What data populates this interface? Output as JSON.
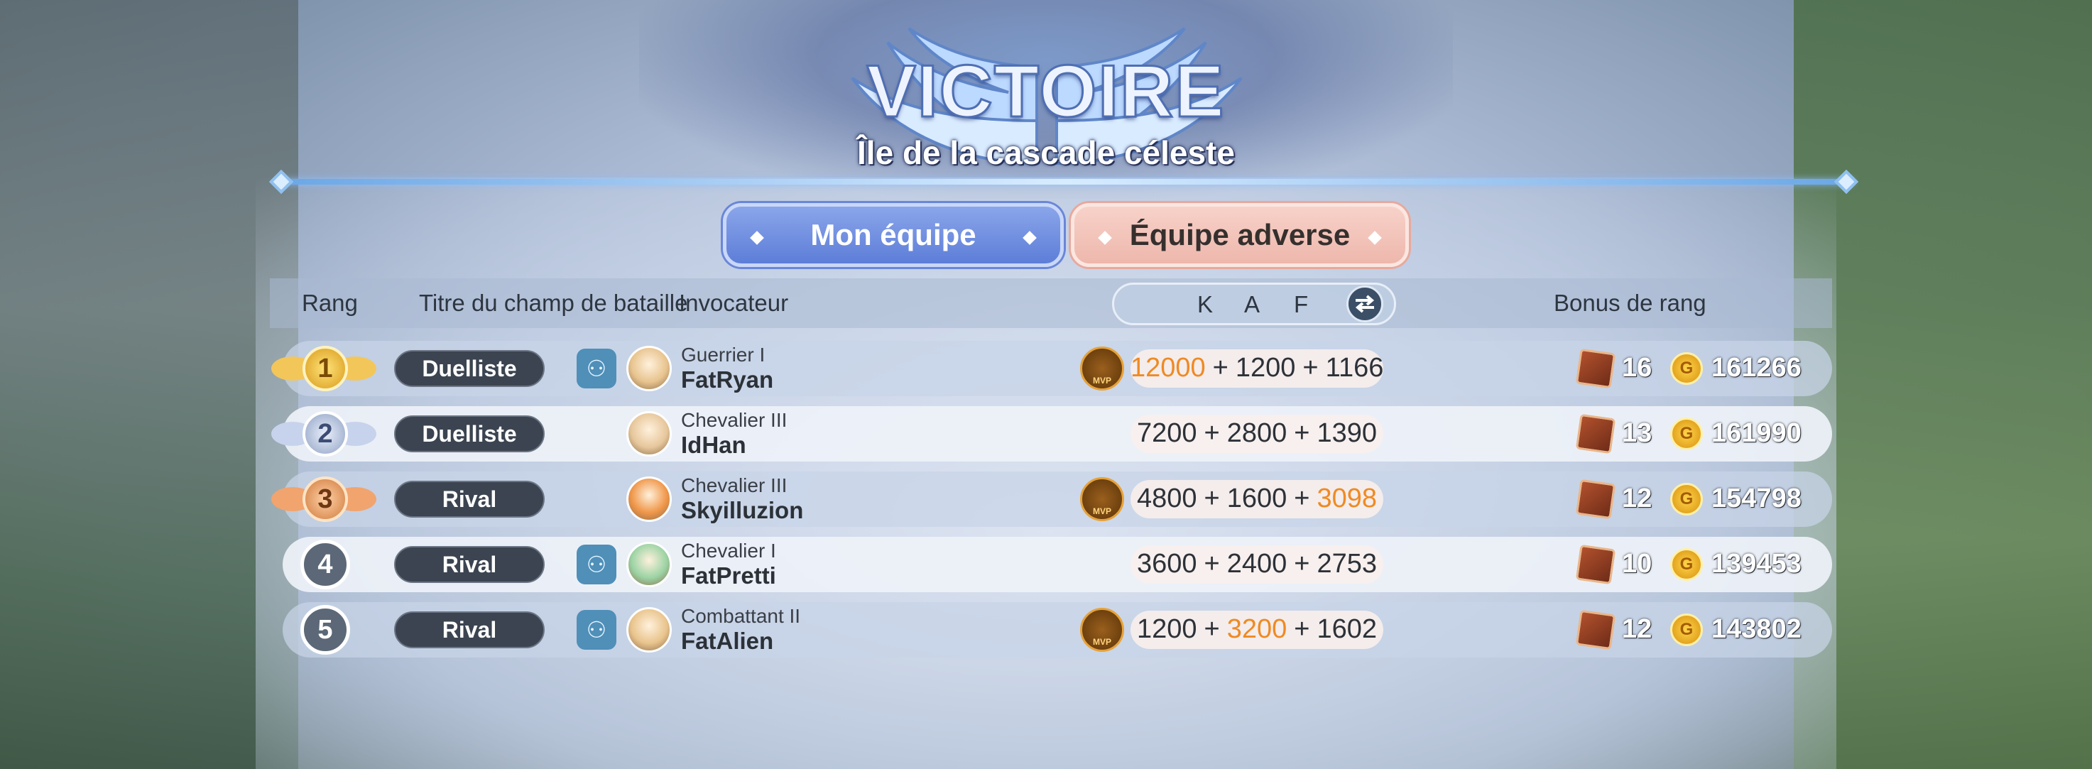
{
  "header": {
    "title": "VICTOIRE",
    "subtitle": "Île de la cascade céleste"
  },
  "tabs": {
    "mine": "Mon équipe",
    "enemy": "Équipe adverse"
  },
  "columns": {
    "rank": "Rang",
    "title": "Titre du champ de bataille",
    "summoner": "Invocateur",
    "k": "K",
    "a": "A",
    "f": "F",
    "bonus": "Bonus de rang"
  },
  "rows": [
    {
      "rank": "1",
      "title": "Duelliste",
      "party": true,
      "summoner_rank": "Guerrier I",
      "name": "FatRyan",
      "mvp": true,
      "mvp_label": "MVP",
      "k": "12000",
      "a": "1200",
      "f": "1166",
      "highlight": "k",
      "boxes": "16",
      "gold": "161266"
    },
    {
      "rank": "2",
      "title": "Duelliste",
      "party": false,
      "summoner_rank": "Chevalier III",
      "name": "IdHan",
      "mvp": false,
      "mvp_label": "",
      "k": "7200",
      "a": "2800",
      "f": "1390",
      "highlight": "",
      "boxes": "13",
      "gold": "161990"
    },
    {
      "rank": "3",
      "title": "Rival",
      "party": false,
      "summoner_rank": "Chevalier III",
      "name": "Skyilluzion",
      "mvp": true,
      "mvp_label": "MVP",
      "k": "4800",
      "a": "1600",
      "f": "3098",
      "highlight": "f",
      "boxes": "12",
      "gold": "154798"
    },
    {
      "rank": "4",
      "title": "Rival",
      "party": true,
      "summoner_rank": "Chevalier I",
      "name": "FatPretti",
      "mvp": false,
      "mvp_label": "",
      "k": "3600",
      "a": "2400",
      "f": "2753",
      "highlight": "",
      "boxes": "10",
      "gold": "139453"
    },
    {
      "rank": "5",
      "title": "Rival",
      "party": true,
      "summoner_rank": "Combattant II",
      "name": "FatAlien",
      "mvp": true,
      "mvp_label": "MVP",
      "k": "1200",
      "a": "3200",
      "f": "1602",
      "highlight": "a",
      "boxes": "12",
      "gold": "143802"
    }
  ],
  "plus": "+",
  "coin_glyph": "G",
  "colors": {
    "highlight": "#ef8a24",
    "tab_mine": "#6c8ce0",
    "tab_enemy": "#f0bfb4"
  }
}
